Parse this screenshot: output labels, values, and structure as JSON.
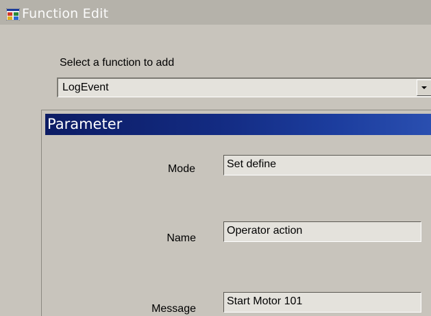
{
  "window": {
    "title": "Function Edit",
    "icon": "window-app-icon"
  },
  "function_select": {
    "label": "Select a function to add",
    "selected": "LogEvent"
  },
  "parameter_group": {
    "header": "Parameter",
    "fields": [
      {
        "label": "Mode",
        "value": "Set define"
      },
      {
        "label": "Name",
        "value": "Operator action"
      },
      {
        "label": "Message",
        "value": "Start Motor 101"
      }
    ]
  },
  "colors": {
    "header_gradient_start": "#0c1c64",
    "header_gradient_end": "#2a4fb0",
    "window_bg": "#c8c4bc"
  }
}
